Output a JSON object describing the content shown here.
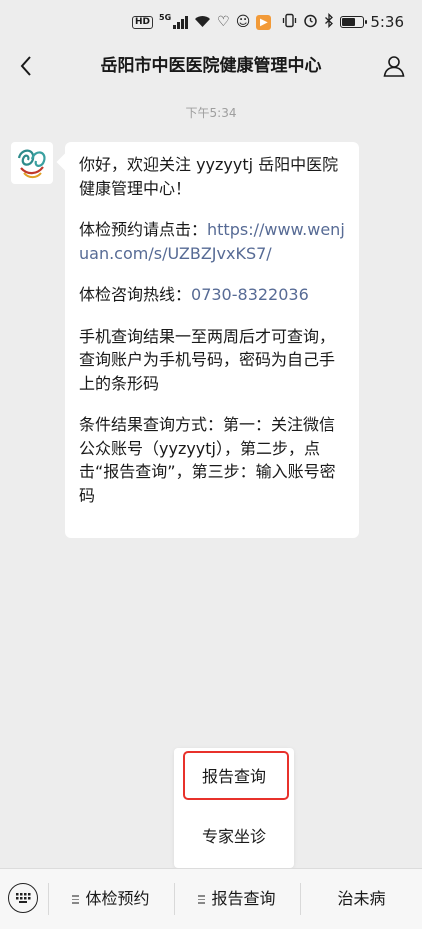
{
  "status_bar": {
    "hd_label": "HD",
    "network_label": "5G",
    "time": "5:36",
    "icons": [
      "hd-icon",
      "signal-icon",
      "wifi-icon",
      "heart-icon",
      "smiley-icon",
      "app-icon",
      "vibrate-icon",
      "alarm-icon",
      "bluetooth-icon",
      "battery-icon"
    ]
  },
  "nav": {
    "title": "岳阳市中医医院健康管理中心",
    "back_icon": "chevron-left-icon",
    "profile_icon": "person-icon"
  },
  "chat": {
    "timestamp": "下午5:34",
    "message": {
      "p1": "你好，欢迎关注 yyzyytj 岳阳中医院健康管理中心！",
      "p2_label": "体检预约请点击：",
      "p2_link": "https://www.wenjuan.com/s/UZBZJvxKS7/",
      "p3_label": "体检咨询热线：",
      "p3_phone": "0730-8322036",
      "p4": "手机查询结果一至两周后才可查询，查询账户为手机号码，密码为自己手上的条形码",
      "p5": "条件结果查询方式：第一：关注微信公众账号（yyzyytj），第二步，点击“报告查询”，第三步：输入账号密码"
    }
  },
  "popup_menu": {
    "items": [
      {
        "label": "报告查询"
      },
      {
        "label": "专家坐诊"
      }
    ]
  },
  "bottom_menu": {
    "keyboard_icon": "keyboard-icon",
    "tabs": [
      {
        "label": "体检预约"
      },
      {
        "label": "报告查询"
      },
      {
        "label": "治未病"
      }
    ]
  },
  "colors": {
    "link": "#576b95",
    "highlight": "#e8312b",
    "background": "#ededed"
  }
}
